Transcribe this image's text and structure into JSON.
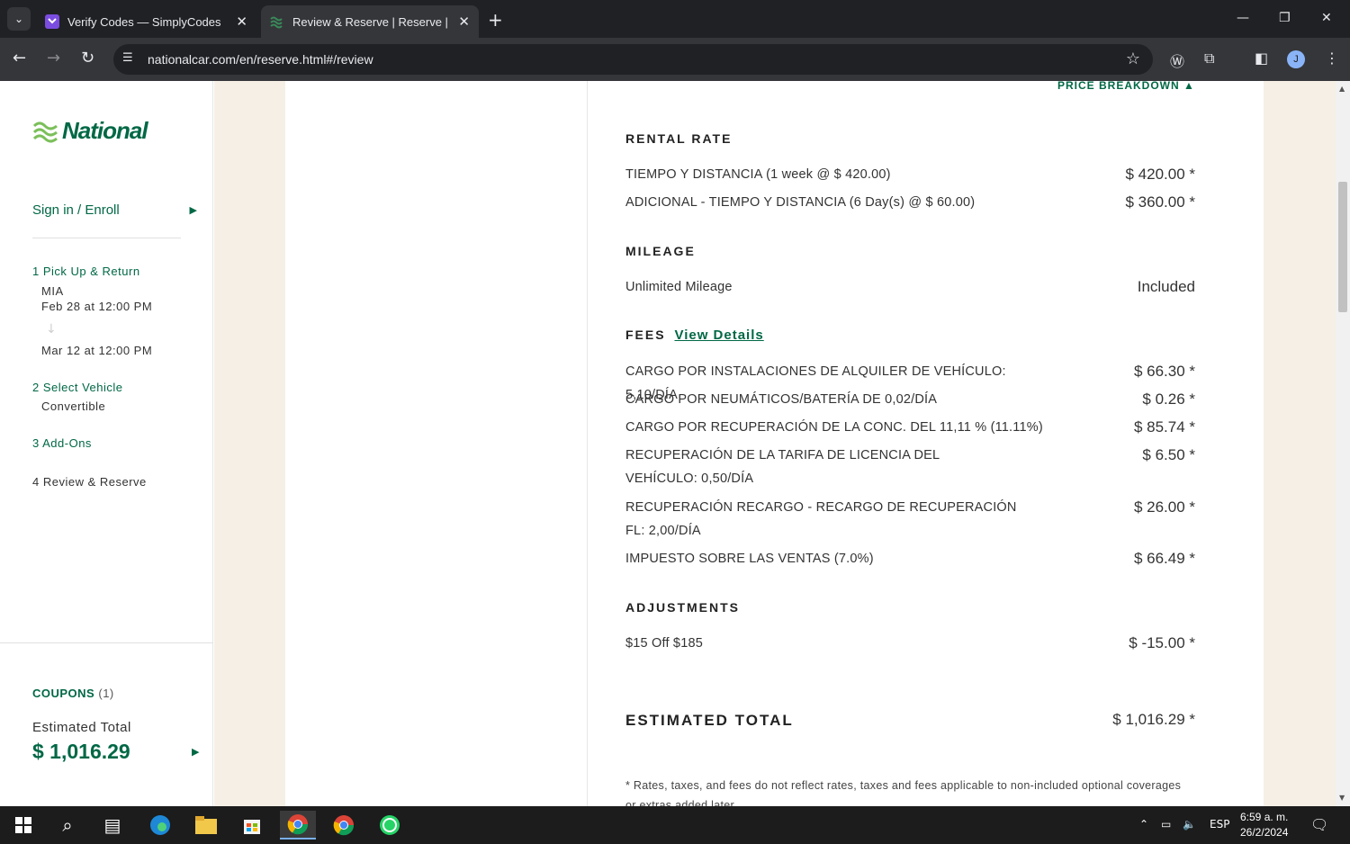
{
  "browser": {
    "tabs": [
      {
        "title": "Verify Codes — SimplyCodes",
        "active": false
      },
      {
        "title": "Review & Reserve | Reserve | National",
        "active": true
      }
    ],
    "url": "nationalcar.com/en/reserve.html#/review"
  },
  "sidebar": {
    "logo_text": "National",
    "signin_label": "Sign in / Enroll",
    "steps": [
      {
        "title": "1 Pick Up & Return",
        "details": [
          "MIA",
          "Feb 28 at 12:00 PM",
          "Mar 12 at 12:00 PM"
        ]
      },
      {
        "title": "2 Select Vehicle",
        "details": [
          "Convertible"
        ]
      },
      {
        "title": "3 Add-Ons",
        "details": []
      },
      {
        "title": "4 Review & Reserve",
        "details": []
      }
    ],
    "coupons_label": "COUPONS",
    "coupons_count": "(1)",
    "estimated_total_label": "Estimated Total",
    "estimated_total_value": "$ 1,016.29"
  },
  "breakdown": {
    "toggle_label": "PRICE BREAKDOWN",
    "rental_rate": {
      "heading": "RENTAL RATE",
      "items": [
        {
          "label": "TIEMPO Y DISTANCIA (1 week @ $ 420.00)",
          "amount": "$ 420.00 *"
        },
        {
          "label": "ADICIONAL - TIEMPO Y DISTANCIA (6 Day(s) @ $ 60.00)",
          "amount": "$ 360.00 *"
        }
      ]
    },
    "mileage": {
      "heading": "MILEAGE",
      "items": [
        {
          "label": "Unlimited Mileage",
          "amount": "Included"
        }
      ]
    },
    "fees": {
      "heading": "FEES",
      "link": "View Details",
      "items": [
        {
          "label": "CARGO POR INSTALACIONES DE ALQUILER DE VEHÍCULO: 5,10/DÍA",
          "amount": "$ 66.30 *"
        },
        {
          "label": "CARGO POR NEUMÁTICOS/BATERÍA DE 0,02/DÍA",
          "amount": "$ 0.26 *"
        },
        {
          "label": "CARGO POR RECUPERACIÓN DE LA CONC. DEL 11,11 % (11.11%)",
          "amount": "$ 85.74 *"
        },
        {
          "label": "RECUPERACIÓN DE LA TARIFA DE LICENCIA DEL VEHÍCULO: 0,50/DÍA",
          "amount": "$ 6.50 *"
        },
        {
          "label": "RECUPERACIÓN RECARGO - RECARGO DE RECUPERACIÓN FL: 2,00/DÍA",
          "amount": "$ 26.00 *"
        },
        {
          "label": "IMPUESTO SOBRE LAS VENTAS (7.0%)",
          "amount": "$ 66.49 *"
        }
      ]
    },
    "adjustments": {
      "heading": "ADJUSTMENTS",
      "items": [
        {
          "label": "$15 Off $185",
          "amount": "$ -15.00 *"
        }
      ]
    },
    "total_label": "ESTIMATED TOTAL",
    "total_amount": "$ 1,016.29 *",
    "footnote": "* Rates, taxes, and fees do not reflect rates, taxes and fees applicable to non-included optional coverages or extras added later."
  },
  "taskbar": {
    "language": "ESP",
    "time": "6:59 a. m.",
    "date": "26/2/2024"
  },
  "colors": {
    "brand_green": "#006845",
    "beige": "#f5efe6"
  }
}
